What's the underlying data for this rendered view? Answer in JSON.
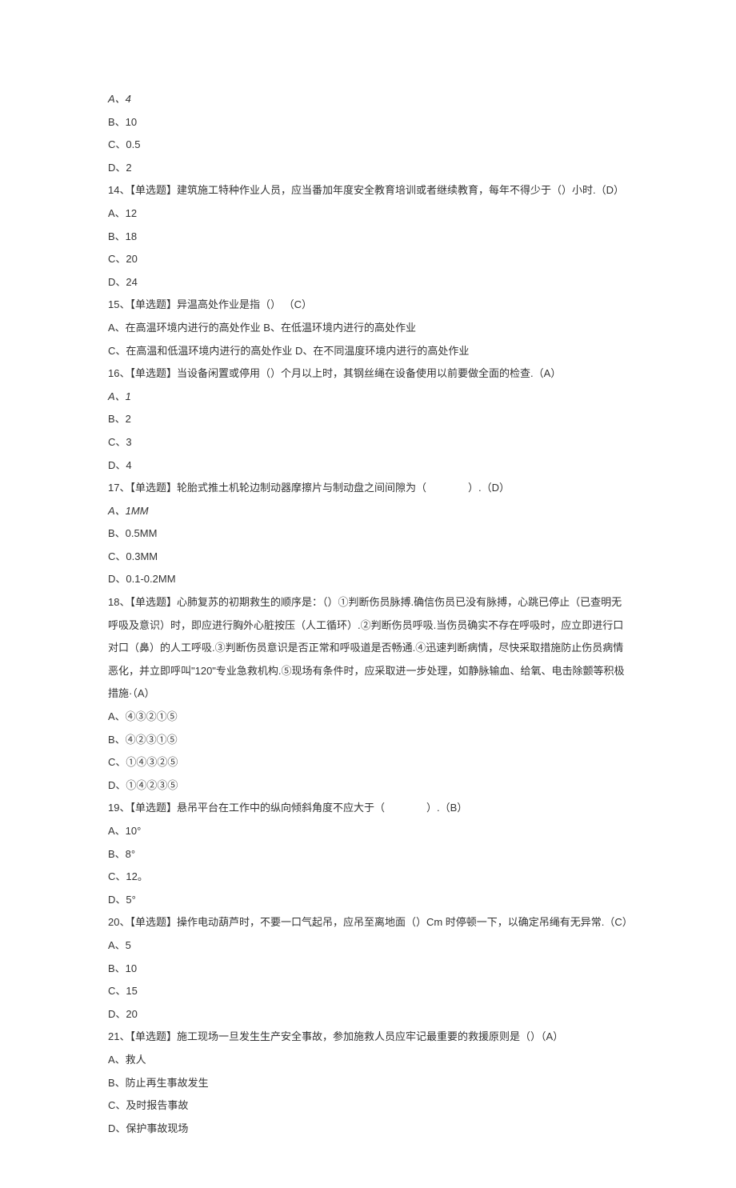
{
  "lines": [
    {
      "text": "A、4",
      "italic": true
    },
    {
      "text": "B、10"
    },
    {
      "text": "C、0.5"
    },
    {
      "text": "D、2"
    },
    {
      "text": "14、【单选题】建筑施工特种作业人员，应当番加年度安全教育培训或者继续教育，每年不得少于（）小时.（D）"
    },
    {
      "text": "A、12"
    },
    {
      "text": "B、18"
    },
    {
      "text": "C、20"
    },
    {
      "text": "D、24"
    },
    {
      "text": "15、【单选题】异温高处作业是指（） （C）"
    },
    {
      "text": "A、在高温环境内进行的高处作业 B、在低温环境内进行的高处作业"
    },
    {
      "text": "C、在高温和低温环境内进行的高处作业 D、在不同温度环境内进行的高处作业"
    },
    {
      "text": "16、【单选题】当设备闲置或停用（）个月以上时，其钢丝绳在设备使用以前要做全面的检查.（A）"
    },
    {
      "text": "A、1",
      "italic": true
    },
    {
      "text": "B、2"
    },
    {
      "text": "C、3"
    },
    {
      "text": "D、4"
    },
    {
      "text": "17、【单选题】轮胎式推土机轮边制动器摩擦片与制动盘之间间隙为（　　　　）.（D）"
    },
    {
      "text": "A、1MM",
      "italic": true
    },
    {
      "text": "B、0.5MM"
    },
    {
      "text": "C、0.3MM"
    },
    {
      "text": "D、0.1-0.2MM"
    },
    {
      "text": "18、【单选题】心肺复苏的初期救生的顺序是：（）①判断伤员脉搏.确信伤员已没有脉搏，心跳已停止（已查明无呼吸及意识）时，即应进行胸外心脏按压（人工循环）.②判断伤员呼吸.当伤员确实不存在呼吸时，应立即进行口对口（鼻）的人工呼吸.③判断伤员意识是否正常和呼吸道是否畅通.④迅速判断病情，尽快采取措施防止伤员病情恶化，并立即呼叫\"120\"专业急救机构.⑤现场有条件时，应采取进一步处理，如静脉输血、给氧、电击除颤等积极措施·（A）"
    },
    {
      "text": "A、④③②①⑤"
    },
    {
      "text": "B、④②③①⑤"
    },
    {
      "text": "C、①④③②⑤"
    },
    {
      "text": "D、①④②③⑤"
    },
    {
      "text": "19、【单选题】悬吊平台在工作中的纵向倾斜角度不应大于（　　　　）.（B）"
    },
    {
      "text": "A、10°"
    },
    {
      "text": "B、8°"
    },
    {
      "text": "C、12。"
    },
    {
      "text": "D、5°"
    },
    {
      "text": "20、【单选题】操作电动葫芦时，不要一口气起吊，应吊至离地面（）Cm 时停顿一下，以确定吊绳有无异常.（C）A、5"
    },
    {
      "text": "B、10"
    },
    {
      "text": "C、15"
    },
    {
      "text": "D、20"
    },
    {
      "text": "21、【单选题】施工现场一旦发生生产安全事故，参加施救人员应牢记最重要的救援原则是（）（A）"
    },
    {
      "text": "A、救人"
    },
    {
      "text": "B、防止再生事故发生"
    },
    {
      "text": "C、及时报告事故"
    },
    {
      "text": "D、保护事故现场"
    }
  ]
}
